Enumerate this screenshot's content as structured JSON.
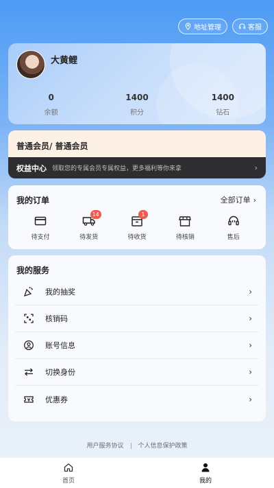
{
  "header": {
    "address_button": "地址管理",
    "service_button": "客服"
  },
  "profile": {
    "nickname": "大黄鲤",
    "stats": [
      {
        "value": "0",
        "label": "余额"
      },
      {
        "value": "1400",
        "label": "积分"
      },
      {
        "value": "1400",
        "label": "钻石"
      }
    ]
  },
  "vip": {
    "title": "普通会员/ 普通会员",
    "bar_title": "权益中心",
    "bar_desc": "领取您的专属会员专属权益，更多福利等你来拿"
  },
  "orders": {
    "title": "我的订单",
    "all_label": "全部订单",
    "items": [
      {
        "label": "待支付",
        "icon": "card-icon"
      },
      {
        "label": "待发货",
        "icon": "truck-icon",
        "badge": "14"
      },
      {
        "label": "待收货",
        "icon": "box-icon",
        "badge": "1"
      },
      {
        "label": "待核销",
        "icon": "shop-icon"
      },
      {
        "label": "售后",
        "icon": "headset-icon"
      }
    ]
  },
  "services": {
    "title": "我的服务",
    "items": [
      {
        "label": "我的抽奖",
        "icon": "party-icon"
      },
      {
        "label": "核销码",
        "icon": "scan-icon"
      },
      {
        "label": "账号信息",
        "icon": "user-circle-icon"
      },
      {
        "label": "切换身份",
        "icon": "switch-icon"
      },
      {
        "label": "优惠券",
        "icon": "coupon-icon"
      }
    ]
  },
  "footer": {
    "user_agreement": "用户服务协议",
    "privacy_policy": "个人信息保护政策"
  },
  "tabbar": {
    "home": "首页",
    "mine": "我的"
  },
  "colors": {
    "primary_blue": "#4d9bf5",
    "badge_red": "#f05a4f",
    "vip_dark": "#2e2e30"
  }
}
